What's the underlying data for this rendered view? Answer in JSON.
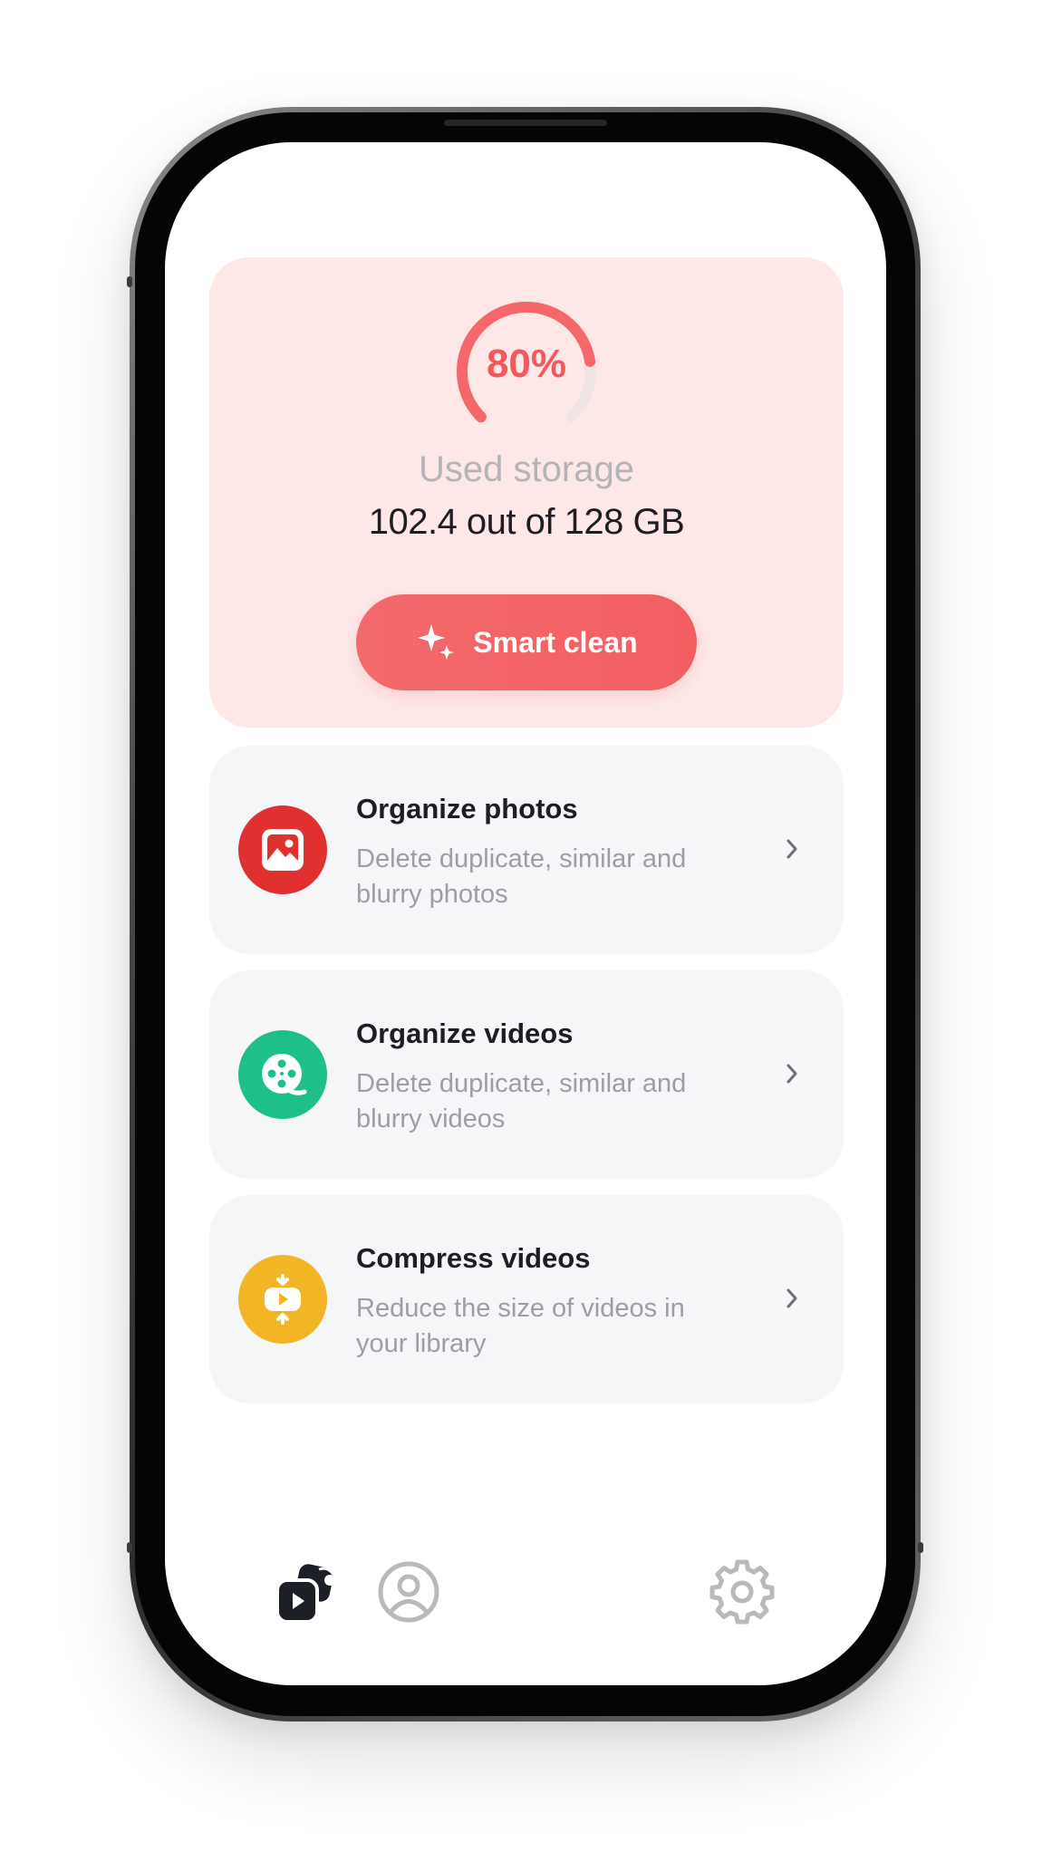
{
  "storage": {
    "percent_label": "80%",
    "percent_value": 0.8,
    "used_label": "Used storage",
    "used_value": "102.4 out of 128 GB",
    "smart_clean_label": "Smart clean"
  },
  "features": [
    {
      "title": "Organize photos",
      "description": "Delete duplicate, similar and blurry photos",
      "icon": "photo-icon",
      "color": "#e0302f"
    },
    {
      "title": "Organize videos",
      "description": "Delete duplicate, similar and blurry videos",
      "icon": "film-reel-icon",
      "color": "#1fbf8c"
    },
    {
      "title": "Compress videos",
      "description": "Reduce the size of videos in your library",
      "icon": "compress-video-icon",
      "color": "#f1b526"
    }
  ],
  "tab_bar": {
    "items": [
      {
        "icon": "media-library-icon",
        "active": true
      },
      {
        "icon": "profile-icon",
        "active": false
      },
      {
        "icon": "settings-gear-icon",
        "active": false
      }
    ]
  },
  "colors": {
    "accent": "#f3585c",
    "card_tint": "#fde7e7",
    "text_dark": "#1d1d24",
    "text_muted": "#9d9da4"
  }
}
